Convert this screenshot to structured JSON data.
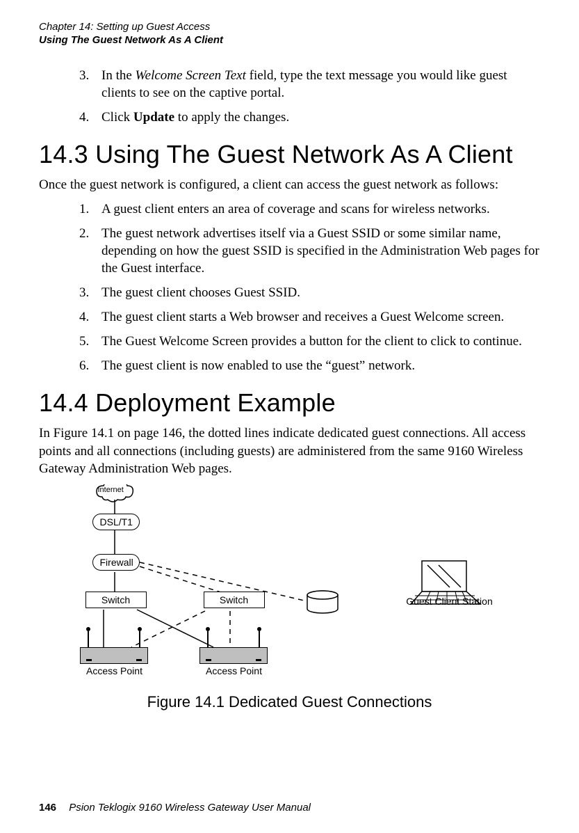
{
  "header": {
    "chapter": "Chapter 14:  Setting up Guest Access",
    "section": "Using The Guest Network As A Client"
  },
  "top_list": {
    "item3": {
      "num": "3.",
      "text_a": "In the ",
      "em": "Welcome Screen Text",
      "text_b": " field, type the text message you would like guest clients to see on the captive portal."
    },
    "item4": {
      "num": "4.",
      "text_a": "Click ",
      "bold": "Update",
      "text_b": " to apply the changes."
    }
  },
  "sec143": {
    "heading": "14.3  Using The Guest Network As A Client",
    "intro": "Once the guest network is configured, a client can access the guest network as follows:",
    "items": {
      "i1": {
        "num": "1.",
        "text": "A guest client enters an area of coverage and scans for wireless networks."
      },
      "i2": {
        "num": "2.",
        "text": "The guest network advertises itself via a Guest SSID or some similar name, depending on how the guest SSID is specified in the Administration Web pages for the Guest interface."
      },
      "i3": {
        "num": "3.",
        "text": "The guest client chooses Guest SSID."
      },
      "i4": {
        "num": "4.",
        "text": "The guest client starts a Web browser and receives a Guest Welcome screen."
      },
      "i5": {
        "num": "5.",
        "text": "The Guest Welcome Screen provides a button for the client to click to continue."
      },
      "i6": {
        "num": "6.",
        "text": "The guest client is now enabled to use the “guest” network."
      }
    }
  },
  "sec144": {
    "heading": "14.4  Deployment Example",
    "para": "In Figure 14.1 on page 146, the dotted lines indicate dedicated guest connections. All access points and all connections (including guests) are administered from the same 9160 Wireless Gateway Administration Web pages."
  },
  "diagram": {
    "internet": "Internet",
    "dsl": "DSL/T1",
    "firewall": "Firewall",
    "switch": "Switch",
    "ap_label": "Access Point",
    "guest": "Guest Client Station"
  },
  "figure_caption": "Figure 14.1 Dedicated Guest Connections",
  "footer": {
    "pageno": "146",
    "manual": "Psion Teklogix 9160 Wireless Gateway User Manual"
  }
}
